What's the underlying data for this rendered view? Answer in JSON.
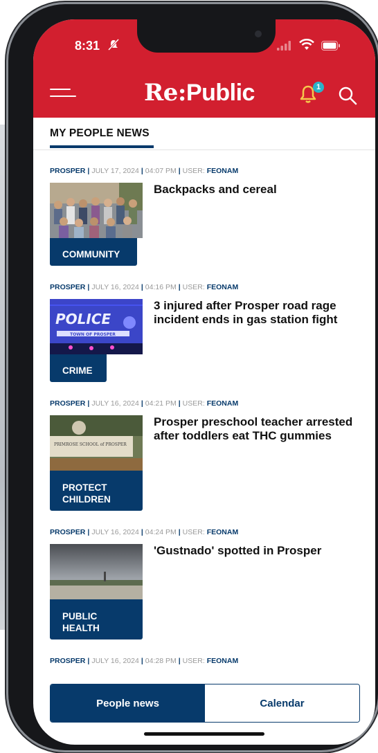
{
  "status_bar": {
    "time": "8:31"
  },
  "header": {
    "logo_re": "Re:",
    "logo_public": "Public",
    "notification_count": "1"
  },
  "section": {
    "title": "MY PEOPLE NEWS"
  },
  "articles": [
    {
      "city": "PROSPER",
      "date": "JULY 17, 2024",
      "time": "04:07 PM",
      "user_label": "USER:",
      "user": "FEONAM",
      "category": "COMMUNITY",
      "headline": "Backpacks and cereal"
    },
    {
      "city": "PROSPER",
      "date": "JULY 16, 2024",
      "time": "04:16 PM",
      "user_label": "USER:",
      "user": "FEONAM",
      "category": "CRIME",
      "headline": "3 injured after Prosper road rage incident ends in gas station fight"
    },
    {
      "city": "PROSPER",
      "date": "JULY 16, 2024",
      "time": "04:21 PM",
      "user_label": "USER:",
      "user": "FEONAM",
      "category": "PROTECT CHILDREN",
      "headline": "Prosper preschool teacher arrested after toddlers eat THC gummies"
    },
    {
      "city": "PROSPER",
      "date": "JULY 16, 2024",
      "time": "04:24 PM",
      "user_label": "USER:",
      "user": "FEONAM",
      "category": "PUBLIC HEALTH",
      "headline": "'Gustnado' spotted in Prosper"
    },
    {
      "city": "PROSPER",
      "date": "JULY 16, 2024",
      "time": "04:28 PM",
      "user_label": "USER:",
      "user": "FEONAM"
    }
  ],
  "images": {
    "police_sign": "POLICE",
    "police_sub": "TOWN OF PROSPER",
    "school_sign": "PRIMROSE SCHOOL of PROSPER"
  },
  "tabs": {
    "active": "People news",
    "inactive": "Calendar"
  },
  "colors": {
    "header_red": "#d21f2f",
    "navy": "#073a6b",
    "badge": "#2bb3c9"
  }
}
